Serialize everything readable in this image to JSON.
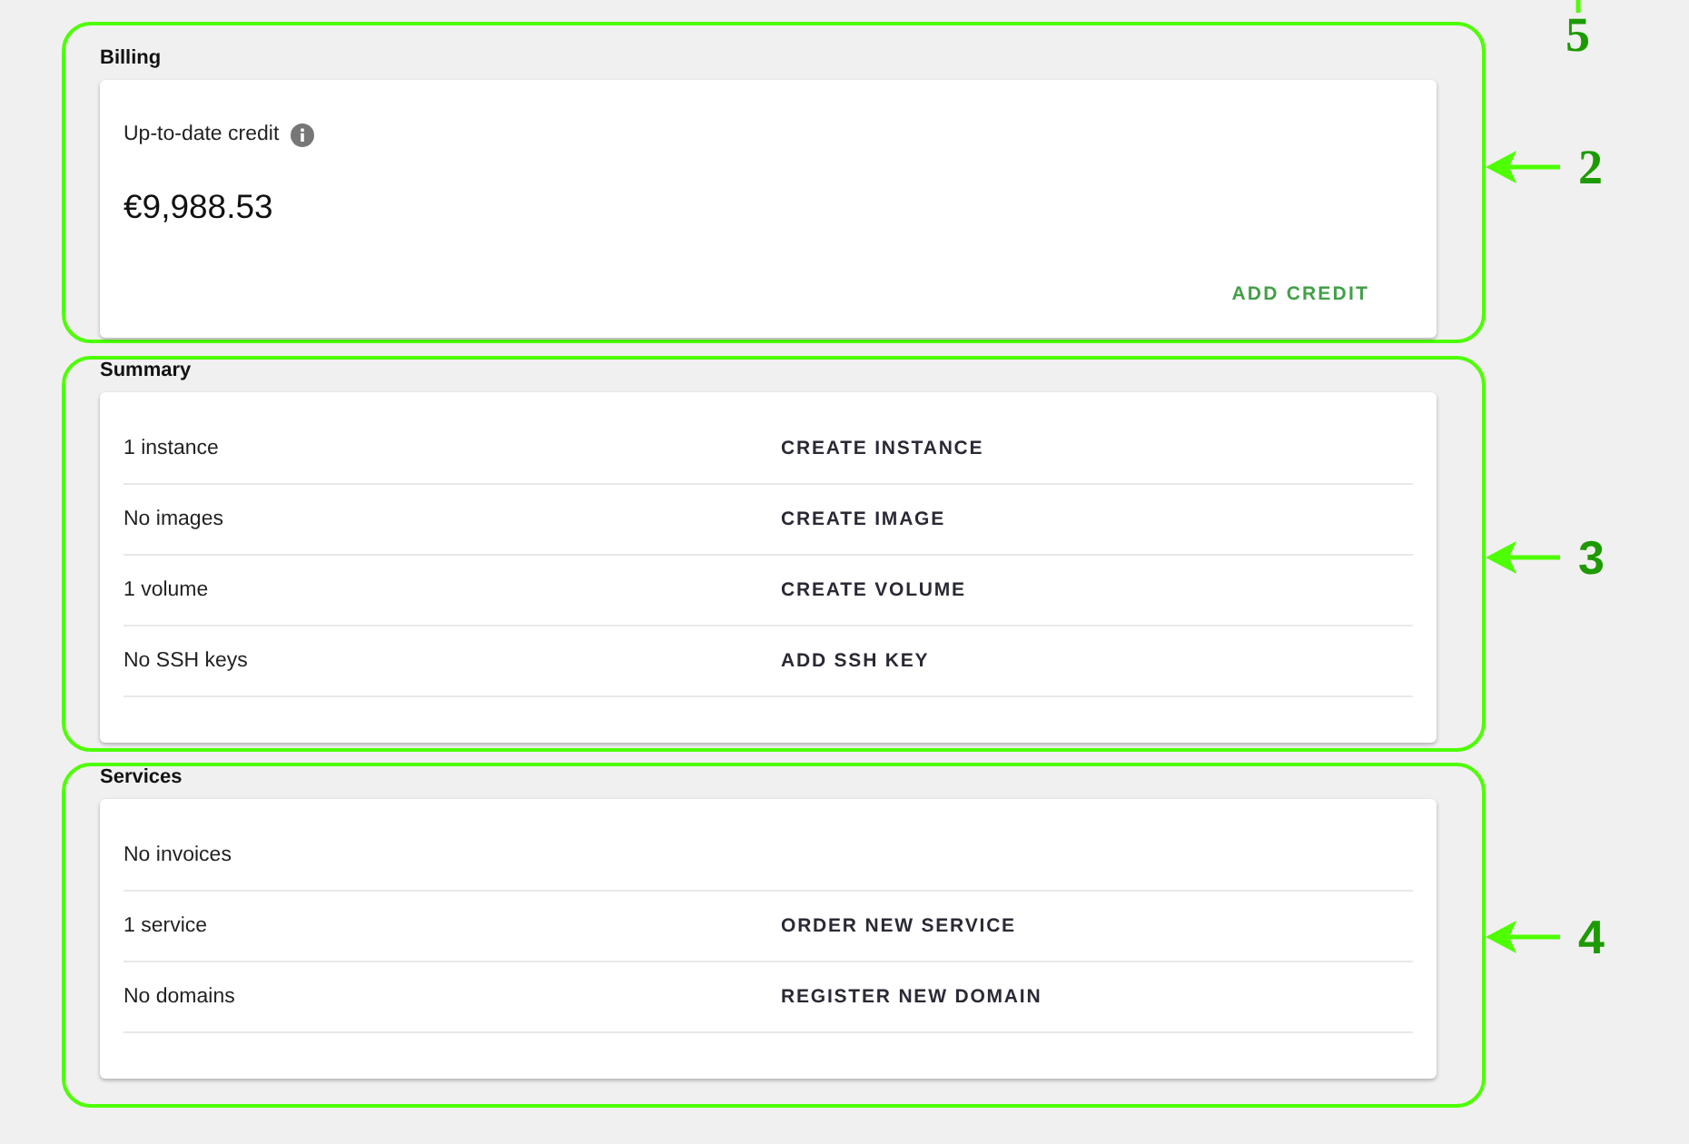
{
  "top_marker": {
    "label": "5",
    "kind": "serif"
  },
  "billing": {
    "heading": "Billing",
    "credit_label": "Up-to-date credit",
    "credit_amount": "€9,988.53",
    "action": "ADD CREDIT",
    "marker": {
      "label": "2",
      "kind": "serif"
    }
  },
  "summary": {
    "heading": "Summary",
    "rows": [
      {
        "text": "1 instance",
        "action": "CREATE INSTANCE"
      },
      {
        "text": "No images",
        "action": "CREATE IMAGE"
      },
      {
        "text": "1 volume",
        "action": "CREATE VOLUME"
      },
      {
        "text": "No SSH keys",
        "action": "ADD SSH KEY"
      }
    ],
    "marker": {
      "label": "3",
      "kind": "sans"
    }
  },
  "services": {
    "heading": "Services",
    "rows": [
      {
        "text": "No invoices"
      },
      {
        "text": "1 service",
        "action": "ORDER NEW SERVICE"
      },
      {
        "text": "No domains",
        "action": "REGISTER NEW DOMAIN"
      }
    ],
    "marker": {
      "label": "4",
      "kind": "sans"
    }
  }
}
